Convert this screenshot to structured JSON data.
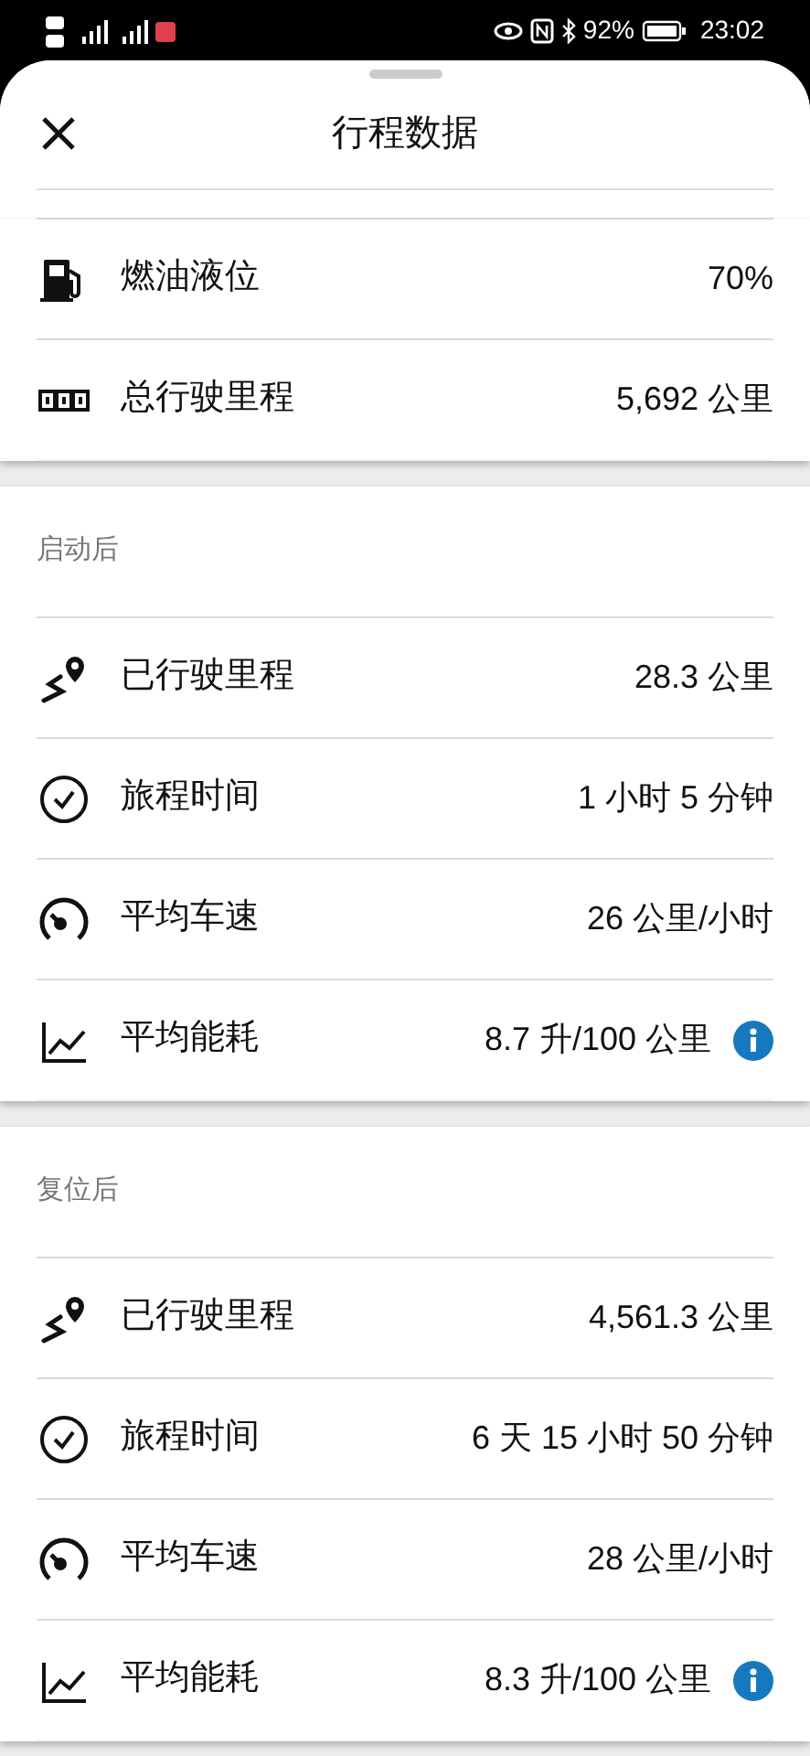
{
  "status_bar": {
    "battery": "92%",
    "time": "23:02"
  },
  "header": {
    "title": "行程数据"
  },
  "summary": [
    {
      "kind": "fuel",
      "label": "燃油液位",
      "value": "70%",
      "info": false
    },
    {
      "kind": "odometer",
      "label": "总行驶里程",
      "value": "5,692 公里",
      "info": false
    }
  ],
  "sections": [
    {
      "title": "启动后",
      "rows": [
        {
          "kind": "distance",
          "label": "已行驶里程",
          "value": "28.3 公里",
          "info": false
        },
        {
          "kind": "time",
          "label": "旅程时间",
          "value": "1 小时 5 分钟",
          "info": false
        },
        {
          "kind": "speed",
          "label": "平均车速",
          "value": "26 公里/小时",
          "info": false
        },
        {
          "kind": "consumption",
          "label": "平均能耗",
          "value": "8.7 升/100 公里",
          "info": true
        }
      ]
    },
    {
      "title": "复位后",
      "rows": [
        {
          "kind": "distance",
          "label": "已行驶里程",
          "value": "4,561.3 公里",
          "info": false
        },
        {
          "kind": "time",
          "label": "旅程时间",
          "value": "6 天 15 小时 50 分钟",
          "info": false
        },
        {
          "kind": "speed",
          "label": "平均车速",
          "value": "28 公里/小时",
          "info": false
        },
        {
          "kind": "consumption",
          "label": "平均能耗",
          "value": "8.3 升/100 公里",
          "info": true
        }
      ]
    }
  ]
}
